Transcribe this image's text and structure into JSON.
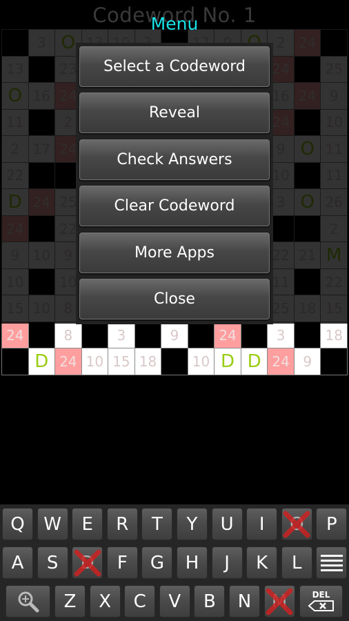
{
  "title": "Codeword No. 1",
  "menu": {
    "title": "Menu",
    "items": [
      {
        "label": "Select a Codeword"
      },
      {
        "label": "Reveal"
      },
      {
        "label": "Check Answers"
      },
      {
        "label": "Clear Codeword"
      },
      {
        "label": "More Apps"
      },
      {
        "label": "Close"
      }
    ]
  },
  "grid": {
    "size": 13,
    "legend": {
      "B": "black square",
      "24p": "highlighted cell (number 24)",
      "letter": "solved letter"
    },
    "rows": [
      [
        "B",
        "3",
        "O",
        "13",
        "10",
        "3",
        "B",
        "17",
        "9",
        "O",
        "2",
        "24p",
        "B"
      ],
      [
        "13",
        "B",
        "23",
        "",
        "",
        "",
        "",
        "",
        "",
        "",
        "24p",
        "B",
        "25"
      ],
      [
        "O",
        "16",
        "24p",
        "",
        "",
        "",
        "",
        "",
        "",
        "",
        "16",
        "24p",
        "9"
      ],
      [
        "11",
        "B",
        "2",
        "",
        "",
        "",
        "",
        "",
        "",
        "",
        "24p",
        "B",
        "10"
      ],
      [
        "2",
        "17",
        "24p",
        "",
        "",
        "",
        "",
        "",
        "",
        "",
        "9",
        "O",
        "11"
      ],
      [
        "22",
        "B",
        "B",
        "",
        "",
        "",
        "",
        "",
        "",
        "",
        "10",
        "B",
        "11"
      ],
      [
        "D",
        "24p",
        "25",
        "",
        "",
        "",
        "",
        "",
        "",
        "",
        "3",
        "O",
        "26"
      ],
      [
        "24p",
        "B",
        "22",
        "",
        "",
        "",
        "",
        "",
        "",
        "",
        "B",
        "B",
        "2"
      ],
      [
        "9",
        "10",
        "9",
        "",
        "",
        "",
        "",
        "",
        "",
        "",
        "22",
        "21",
        "M"
      ],
      [
        "10",
        "B",
        "10",
        "",
        "",
        "",
        "",
        "",
        "",
        "",
        "11",
        "B",
        "22"
      ],
      [
        "15",
        "10",
        "8",
        "",
        "",
        "",
        "",
        "",
        "",
        "",
        "25",
        "18",
        "15"
      ],
      [
        "24p",
        "B",
        "8",
        "B",
        "3",
        "B",
        "9",
        "B",
        "24p",
        "B",
        "3",
        "B",
        "18"
      ],
      [
        "B",
        "D",
        "24p",
        "10",
        "15",
        "18",
        "B",
        "10",
        "D",
        "D",
        "24p",
        "9",
        "B"
      ]
    ]
  },
  "keyboard": {
    "rows": [
      [
        {
          "k": "Q"
        },
        {
          "k": "W"
        },
        {
          "k": "E"
        },
        {
          "k": "R"
        },
        {
          "k": "T"
        },
        {
          "k": "Y"
        },
        {
          "k": "U"
        },
        {
          "k": "I"
        },
        {
          "k": "O",
          "used": true
        },
        {
          "k": "P"
        }
      ],
      [
        {
          "k": "A"
        },
        {
          "k": "S"
        },
        {
          "k": "D",
          "used": true
        },
        {
          "k": "F"
        },
        {
          "k": "G"
        },
        {
          "k": "H"
        },
        {
          "k": "J"
        },
        {
          "k": "K"
        },
        {
          "k": "L"
        },
        {
          "k": "menu",
          "icon": "menu-icon"
        }
      ],
      [
        {
          "k": "zoom",
          "icon": "magnifier-zoom-icon"
        },
        {
          "k": "Z"
        },
        {
          "k": "X"
        },
        {
          "k": "C"
        },
        {
          "k": "V"
        },
        {
          "k": "B"
        },
        {
          "k": "N"
        },
        {
          "k": "M",
          "used": true
        },
        {
          "k": "DEL",
          "icon": "backspace-icon"
        }
      ]
    ]
  },
  "colors": {
    "menu_title": "#19e3e8",
    "highlight": "#ff9e9e",
    "solved_letter": "#99cc11",
    "used_cross": "#cc2222"
  }
}
